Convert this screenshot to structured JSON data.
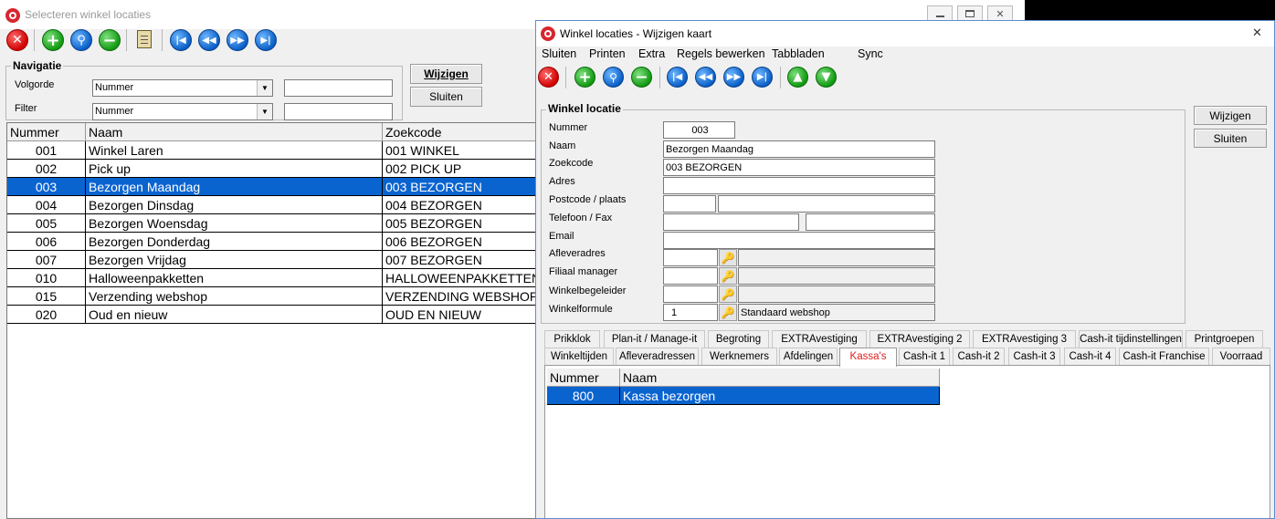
{
  "back_window": {
    "title": "Selecteren winkel locaties",
    "nav_group": "Navigatie",
    "volgorde_label": "Volgorde",
    "filter_label": "Filter",
    "volgorde_value": "Nummer",
    "filter_value": "Nummer",
    "volgorde_text": "",
    "filter_text": "",
    "wijzigen": "Wijzigen",
    "sluiten": "Sluiten",
    "columns": [
      "Nummer",
      "Naam",
      "Zoekcode"
    ],
    "rows": [
      {
        "nummer": "001",
        "naam": "Winkel Laren",
        "zoekcode": "001 WINKEL"
      },
      {
        "nummer": "002",
        "naam": "Pick up",
        "zoekcode": "002 PICK UP"
      },
      {
        "nummer": "003",
        "naam": "Bezorgen Maandag",
        "zoekcode": "003 BEZORGEN"
      },
      {
        "nummer": "004",
        "naam": "Bezorgen Dinsdag",
        "zoekcode": "004 BEZORGEN"
      },
      {
        "nummer": "005",
        "naam": "Bezorgen Woensdag",
        "zoekcode": "005 BEZORGEN"
      },
      {
        "nummer": "006",
        "naam": "Bezorgen Donderdag",
        "zoekcode": "006 BEZORGEN"
      },
      {
        "nummer": "007",
        "naam": "Bezorgen Vrijdag",
        "zoekcode": "007 BEZORGEN"
      },
      {
        "nummer": "010",
        "naam": "Halloweenpakketten",
        "zoekcode": "HALLOWEENPAKKETTEN"
      },
      {
        "nummer": "015",
        "naam": "Verzending webshop",
        "zoekcode": "VERZENDING WEBSHOP"
      },
      {
        "nummer": "020",
        "naam": "Oud en nieuw",
        "zoekcode": "OUD EN NIEUW"
      }
    ],
    "selected_index": 2
  },
  "front_window": {
    "title": "Winkel locaties - Wijzigen kaart",
    "menu": [
      "Sluiten",
      "Printen",
      "Extra",
      "Regels bewerken",
      "Tabbladen",
      "Sync"
    ],
    "group_title": "Winkel locatie",
    "fields": {
      "nummer": {
        "label": "Nummer",
        "value": "003"
      },
      "naam": {
        "label": "Naam",
        "value": "Bezorgen Maandag"
      },
      "zoekcode": {
        "label": "Zoekcode",
        "value": "003 BEZORGEN"
      },
      "adres": {
        "label": "Adres",
        "value": ""
      },
      "postcode": {
        "label": "Postcode / plaats",
        "value": "",
        "plaats": ""
      },
      "telefoon": {
        "label": "Telefoon / Fax",
        "value": "",
        "fax": ""
      },
      "email": {
        "label": "Email",
        "value": ""
      },
      "afleveradres": {
        "label": "Afleveradres",
        "value": "",
        "desc": ""
      },
      "filiaal": {
        "label": "Filiaal manager",
        "value": "",
        "desc": ""
      },
      "begeleider": {
        "label": "Winkelbegeleider",
        "value": "",
        "desc": ""
      },
      "formule": {
        "label": "Winkelformule",
        "value": "1",
        "desc": "Standaard webshop"
      }
    },
    "wijzigen": "Wijzigen",
    "sluiten": "Sluiten",
    "tabs_row1": [
      "Prikklok",
      "Plan-it / Manage-it",
      "Begroting",
      "EXTRAvestiging",
      "EXTRAvestiging 2",
      "EXTRAvestiging 3",
      "Cash-it tijdinstellingen",
      "Printgroepen"
    ],
    "tabs_row2": [
      "Winkeltijden",
      "Afleveradressen",
      "Werknemers",
      "Afdelingen",
      "Kassa's",
      "Cash-it 1",
      "Cash-it 2",
      "Cash-it 3",
      "Cash-it 4",
      "Cash-it Franchise",
      "Voorraad"
    ],
    "active_tab": "Kassa's",
    "kassa_columns": [
      "Nummer",
      "Naam"
    ],
    "kassa_rows": [
      {
        "nummer": "800",
        "naam": "Kassa bezorgen"
      }
    ],
    "close_glyph": "✕"
  },
  "colors": {
    "selection": "#0a64d0",
    "active_tab_text": "#e02020",
    "title_bar": "#ffffff"
  }
}
